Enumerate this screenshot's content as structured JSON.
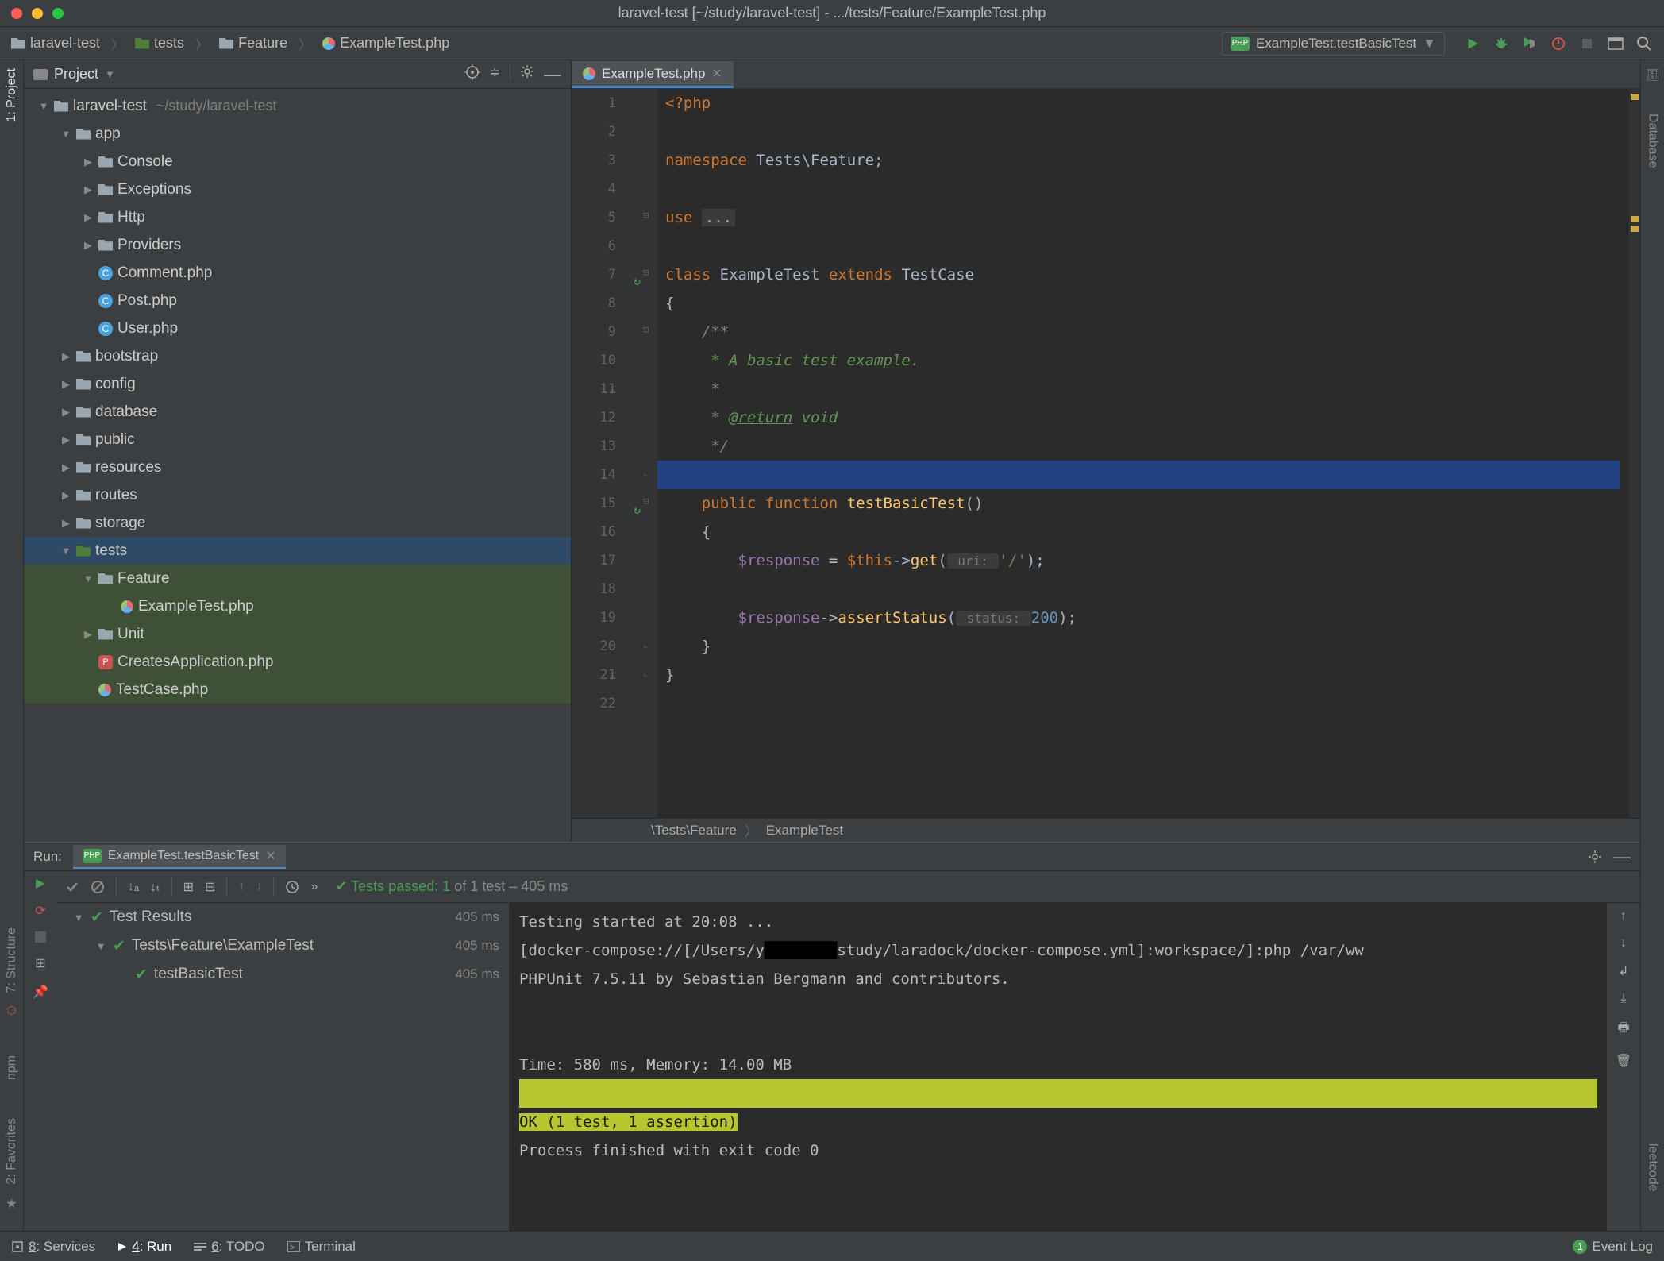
{
  "titlebar": {
    "title": "laravel-test [~/study/laravel-test] - .../tests/Feature/ExampleTest.php"
  },
  "breadcrumb": [
    {
      "icon": "folder",
      "label": "laravel-test"
    },
    {
      "icon": "folder-tests",
      "label": "tests"
    },
    {
      "icon": "folder",
      "label": "Feature"
    },
    {
      "icon": "php",
      "label": "ExampleTest.php"
    }
  ],
  "run_config": {
    "label": "ExampleTest.testBasicTest"
  },
  "project_panel": {
    "title": "Project",
    "root": {
      "label": "laravel-test",
      "path": "~/study/laravel-test"
    },
    "tree": [
      {
        "depth": 0,
        "arrow": "▼",
        "icon": "folder",
        "label": "laravel-test",
        "suffix": "~/study/laravel-test"
      },
      {
        "depth": 1,
        "arrow": "▼",
        "icon": "folder",
        "label": "app"
      },
      {
        "depth": 2,
        "arrow": "▶",
        "icon": "folder",
        "label": "Console"
      },
      {
        "depth": 2,
        "arrow": "▶",
        "icon": "folder",
        "label": "Exceptions"
      },
      {
        "depth": 2,
        "arrow": "▶",
        "icon": "folder",
        "label": "Http"
      },
      {
        "depth": 2,
        "arrow": "▶",
        "icon": "folder",
        "label": "Providers"
      },
      {
        "depth": 2,
        "arrow": "",
        "icon": "class",
        "label": "Comment.php"
      },
      {
        "depth": 2,
        "arrow": "",
        "icon": "class",
        "label": "Post.php"
      },
      {
        "depth": 2,
        "arrow": "",
        "icon": "class",
        "label": "User.php"
      },
      {
        "depth": 1,
        "arrow": "▶",
        "icon": "folder",
        "label": "bootstrap"
      },
      {
        "depth": 1,
        "arrow": "▶",
        "icon": "folder",
        "label": "config"
      },
      {
        "depth": 1,
        "arrow": "▶",
        "icon": "folder",
        "label": "database"
      },
      {
        "depth": 1,
        "arrow": "▶",
        "icon": "folder",
        "label": "public"
      },
      {
        "depth": 1,
        "arrow": "▶",
        "icon": "folder",
        "label": "resources"
      },
      {
        "depth": 1,
        "arrow": "▶",
        "icon": "folder",
        "label": "routes"
      },
      {
        "depth": 1,
        "arrow": "▶",
        "icon": "folder",
        "label": "storage"
      },
      {
        "depth": 1,
        "arrow": "▼",
        "icon": "folder-tests",
        "label": "tests",
        "sel": true
      },
      {
        "depth": 2,
        "arrow": "▼",
        "icon": "folder",
        "label": "Feature",
        "hl": true
      },
      {
        "depth": 3,
        "arrow": "",
        "icon": "php",
        "label": "ExampleTest.php",
        "hl": true
      },
      {
        "depth": 2,
        "arrow": "▶",
        "icon": "folder",
        "label": "Unit",
        "hl": true
      },
      {
        "depth": 2,
        "arrow": "",
        "icon": "phpred",
        "label": "CreatesApplication.php",
        "hl": true
      },
      {
        "depth": 2,
        "arrow": "",
        "icon": "php",
        "label": "TestCase.php",
        "hl": true
      }
    ]
  },
  "editor": {
    "tab_label": "ExampleTest.php",
    "lines": 22,
    "breadcrumb2": [
      "\\Tests\\Feature",
      "ExampleTest"
    ],
    "code": {
      "l1": "<?php",
      "l3a": "namespace",
      "l3b": " Tests\\Feature;",
      "l5a": "use ",
      "l5b": "...",
      "l7a": "class ",
      "l7b": "ExampleTest ",
      "l7c": "extends ",
      "l7d": "TestCase",
      "l8": "{",
      "l9": "    /**",
      "l10": "     * A basic test example.",
      "l11": "     *",
      "l12a": "     * ",
      "l12b": "@return",
      "l12c": " void",
      "l13": "     */",
      "l14a": "    public function ",
      "l14b": "testBasicTest",
      "l14c": "()",
      "l15": "    {",
      "l16a": "        $response",
      "l16b": " = ",
      "l16c": "$this",
      "l16d": "->",
      "l16e": "get",
      "l16f": "(",
      "l16g": " uri: ",
      "l16h": "'/'",
      "l16i": ");",
      "l18a": "        $response",
      "l18b": "->",
      "l18c": "assertStatus",
      "l18d": "(",
      "l18e": " status: ",
      "l18f": "200",
      "l18g": ");",
      "l19": "    }",
      "l20": "}"
    }
  },
  "run": {
    "label": "Run:",
    "tab": "ExampleTest.testBasicTest",
    "summary_prefix": "Tests passed: 1",
    "summary_suffix": " of 1 test – 405 ms",
    "tree": [
      {
        "depth": 0,
        "arrow": "▼",
        "label": "Test Results",
        "time": "405 ms"
      },
      {
        "depth": 1,
        "arrow": "▼",
        "label": "Tests\\Feature\\ExampleTest",
        "time": "405 ms"
      },
      {
        "depth": 2,
        "arrow": "",
        "label": "testBasicTest",
        "time": "405 ms"
      }
    ],
    "console": {
      "l1": "Testing started at 20:08 ...",
      "l2a": "[docker-compose://[/Users/y",
      "l2b": "study/laradock/docker-compose.yml]:workspace/]:php /var/ww",
      "l3": "PHPUnit 7.5.11 by Sebastian Bergmann and contributors.",
      "l6": "Time: 580 ms, Memory: 14.00 MB",
      "l8": "OK (1 test, 1 assertion)",
      "l9": "Process finished with exit code 0"
    }
  },
  "statusbar": {
    "items": [
      {
        "icon": "services",
        "label": "8: Services",
        "underline": "8"
      },
      {
        "icon": "run",
        "label": "4: Run",
        "underline": "4",
        "active": true
      },
      {
        "icon": "todo",
        "label": "6: TODO",
        "underline": "6"
      },
      {
        "icon": "terminal",
        "label": "Terminal"
      }
    ],
    "event_log": "Event Log",
    "event_count": "1"
  },
  "left_rail": {
    "project": "1: Project",
    "structure": "7: Structure",
    "npm": "npm",
    "favorites": "2: Favorites"
  },
  "right_rail": {
    "database": "Database",
    "leetcode": "leetcode"
  }
}
